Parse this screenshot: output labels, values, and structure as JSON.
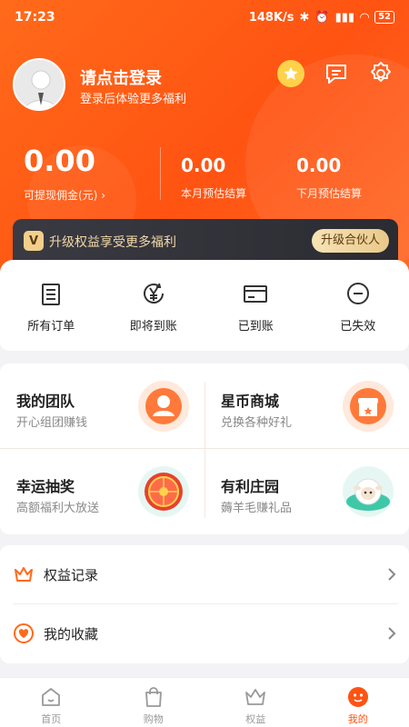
{
  "status": {
    "time": "17:23",
    "speed": "148K/s",
    "battery": "52"
  },
  "profile": {
    "title": "请点击登录",
    "subtitle": "登录后体验更多福利"
  },
  "earnings": {
    "withdrawable_value": "0.00",
    "withdrawable_label": "可提现佣金(元)",
    "this_month_value": "0.00",
    "this_month_label": "本月预估结算",
    "next_month_value": "0.00",
    "next_month_label": "下月预估结算"
  },
  "upgrade": {
    "badge": "V",
    "text": "升级权益享受更多福利",
    "button": "升级合伙人"
  },
  "orders": [
    {
      "label": "所有订单",
      "icon": "clipboard-icon"
    },
    {
      "label": "即将到账",
      "icon": "yen-coin-icon"
    },
    {
      "label": "已到账",
      "icon": "card-icon"
    },
    {
      "label": "已失效",
      "icon": "minus-circle-icon"
    }
  ],
  "features": [
    {
      "title": "我的团队",
      "subtitle": "开心组团赚钱",
      "icon": "team-icon"
    },
    {
      "title": "星币商城",
      "subtitle": "兑换各种好礼",
      "icon": "shop-icon"
    },
    {
      "title": "幸运抽奖",
      "subtitle": "高额福利大放送",
      "icon": "lottery-wheel-icon"
    },
    {
      "title": "有利庄园",
      "subtitle": "薅羊毛赚礼品",
      "icon": "sheep-icon"
    }
  ],
  "list": [
    {
      "label": "权益记录",
      "icon": "crown-icon"
    },
    {
      "label": "我的收藏",
      "icon": "heart-icon"
    }
  ],
  "tabs": [
    {
      "label": "首页",
      "icon": "home-icon",
      "active": false
    },
    {
      "label": "购物",
      "icon": "bag-icon",
      "active": false
    },
    {
      "label": "权益",
      "icon": "crown-icon",
      "active": false
    },
    {
      "label": "我的",
      "icon": "profile-face-icon",
      "active": true
    }
  ],
  "colors": {
    "brand": "#ff5312",
    "upgrade_bg": "#2f2f36",
    "gold": "#f2cf8a"
  }
}
